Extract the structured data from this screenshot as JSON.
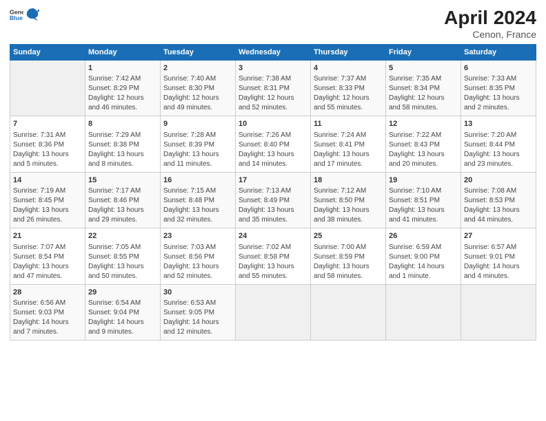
{
  "header": {
    "logo_general": "General",
    "logo_blue": "Blue",
    "title": "April 2024",
    "subtitle": "Cenon, France"
  },
  "days_of_week": [
    "Sunday",
    "Monday",
    "Tuesday",
    "Wednesday",
    "Thursday",
    "Friday",
    "Saturday"
  ],
  "weeks": [
    [
      {
        "num": "",
        "sunrise": "",
        "sunset": "",
        "daylight": "",
        "empty": true
      },
      {
        "num": "1",
        "sunrise": "Sunrise: 7:42 AM",
        "sunset": "Sunset: 8:29 PM",
        "daylight": "Daylight: 12 hours and 46 minutes."
      },
      {
        "num": "2",
        "sunrise": "Sunrise: 7:40 AM",
        "sunset": "Sunset: 8:30 PM",
        "daylight": "Daylight: 12 hours and 49 minutes."
      },
      {
        "num": "3",
        "sunrise": "Sunrise: 7:38 AM",
        "sunset": "Sunset: 8:31 PM",
        "daylight": "Daylight: 12 hours and 52 minutes."
      },
      {
        "num": "4",
        "sunrise": "Sunrise: 7:37 AM",
        "sunset": "Sunset: 8:33 PM",
        "daylight": "Daylight: 12 hours and 55 minutes."
      },
      {
        "num": "5",
        "sunrise": "Sunrise: 7:35 AM",
        "sunset": "Sunset: 8:34 PM",
        "daylight": "Daylight: 12 hours and 58 minutes."
      },
      {
        "num": "6",
        "sunrise": "Sunrise: 7:33 AM",
        "sunset": "Sunset: 8:35 PM",
        "daylight": "Daylight: 13 hours and 2 minutes."
      }
    ],
    [
      {
        "num": "7",
        "sunrise": "Sunrise: 7:31 AM",
        "sunset": "Sunset: 8:36 PM",
        "daylight": "Daylight: 13 hours and 5 minutes."
      },
      {
        "num": "8",
        "sunrise": "Sunrise: 7:29 AM",
        "sunset": "Sunset: 8:38 PM",
        "daylight": "Daylight: 13 hours and 8 minutes."
      },
      {
        "num": "9",
        "sunrise": "Sunrise: 7:28 AM",
        "sunset": "Sunset: 8:39 PM",
        "daylight": "Daylight: 13 hours and 11 minutes."
      },
      {
        "num": "10",
        "sunrise": "Sunrise: 7:26 AM",
        "sunset": "Sunset: 8:40 PM",
        "daylight": "Daylight: 13 hours and 14 minutes."
      },
      {
        "num": "11",
        "sunrise": "Sunrise: 7:24 AM",
        "sunset": "Sunset: 8:41 PM",
        "daylight": "Daylight: 13 hours and 17 minutes."
      },
      {
        "num": "12",
        "sunrise": "Sunrise: 7:22 AM",
        "sunset": "Sunset: 8:43 PM",
        "daylight": "Daylight: 13 hours and 20 minutes."
      },
      {
        "num": "13",
        "sunrise": "Sunrise: 7:20 AM",
        "sunset": "Sunset: 8:44 PM",
        "daylight": "Daylight: 13 hours and 23 minutes."
      }
    ],
    [
      {
        "num": "14",
        "sunrise": "Sunrise: 7:19 AM",
        "sunset": "Sunset: 8:45 PM",
        "daylight": "Daylight: 13 hours and 26 minutes."
      },
      {
        "num": "15",
        "sunrise": "Sunrise: 7:17 AM",
        "sunset": "Sunset: 8:46 PM",
        "daylight": "Daylight: 13 hours and 29 minutes."
      },
      {
        "num": "16",
        "sunrise": "Sunrise: 7:15 AM",
        "sunset": "Sunset: 8:48 PM",
        "daylight": "Daylight: 13 hours and 32 minutes."
      },
      {
        "num": "17",
        "sunrise": "Sunrise: 7:13 AM",
        "sunset": "Sunset: 8:49 PM",
        "daylight": "Daylight: 13 hours and 35 minutes."
      },
      {
        "num": "18",
        "sunrise": "Sunrise: 7:12 AM",
        "sunset": "Sunset: 8:50 PM",
        "daylight": "Daylight: 13 hours and 38 minutes."
      },
      {
        "num": "19",
        "sunrise": "Sunrise: 7:10 AM",
        "sunset": "Sunset: 8:51 PM",
        "daylight": "Daylight: 13 hours and 41 minutes."
      },
      {
        "num": "20",
        "sunrise": "Sunrise: 7:08 AM",
        "sunset": "Sunset: 8:53 PM",
        "daylight": "Daylight: 13 hours and 44 minutes."
      }
    ],
    [
      {
        "num": "21",
        "sunrise": "Sunrise: 7:07 AM",
        "sunset": "Sunset: 8:54 PM",
        "daylight": "Daylight: 13 hours and 47 minutes."
      },
      {
        "num": "22",
        "sunrise": "Sunrise: 7:05 AM",
        "sunset": "Sunset: 8:55 PM",
        "daylight": "Daylight: 13 hours and 50 minutes."
      },
      {
        "num": "23",
        "sunrise": "Sunrise: 7:03 AM",
        "sunset": "Sunset: 8:56 PM",
        "daylight": "Daylight: 13 hours and 52 minutes."
      },
      {
        "num": "24",
        "sunrise": "Sunrise: 7:02 AM",
        "sunset": "Sunset: 8:58 PM",
        "daylight": "Daylight: 13 hours and 55 minutes."
      },
      {
        "num": "25",
        "sunrise": "Sunrise: 7:00 AM",
        "sunset": "Sunset: 8:59 PM",
        "daylight": "Daylight: 13 hours and 58 minutes."
      },
      {
        "num": "26",
        "sunrise": "Sunrise: 6:59 AM",
        "sunset": "Sunset: 9:00 PM",
        "daylight": "Daylight: 14 hours and 1 minute."
      },
      {
        "num": "27",
        "sunrise": "Sunrise: 6:57 AM",
        "sunset": "Sunset: 9:01 PM",
        "daylight": "Daylight: 14 hours and 4 minutes."
      }
    ],
    [
      {
        "num": "28",
        "sunrise": "Sunrise: 6:56 AM",
        "sunset": "Sunset: 9:03 PM",
        "daylight": "Daylight: 14 hours and 7 minutes."
      },
      {
        "num": "29",
        "sunrise": "Sunrise: 6:54 AM",
        "sunset": "Sunset: 9:04 PM",
        "daylight": "Daylight: 14 hours and 9 minutes."
      },
      {
        "num": "30",
        "sunrise": "Sunrise: 6:53 AM",
        "sunset": "Sunset: 9:05 PM",
        "daylight": "Daylight: 14 hours and 12 minutes."
      },
      {
        "num": "",
        "sunrise": "",
        "sunset": "",
        "daylight": "",
        "empty": true
      },
      {
        "num": "",
        "sunrise": "",
        "sunset": "",
        "daylight": "",
        "empty": true
      },
      {
        "num": "",
        "sunrise": "",
        "sunset": "",
        "daylight": "",
        "empty": true
      },
      {
        "num": "",
        "sunrise": "",
        "sunset": "",
        "daylight": "",
        "empty": true
      }
    ]
  ]
}
